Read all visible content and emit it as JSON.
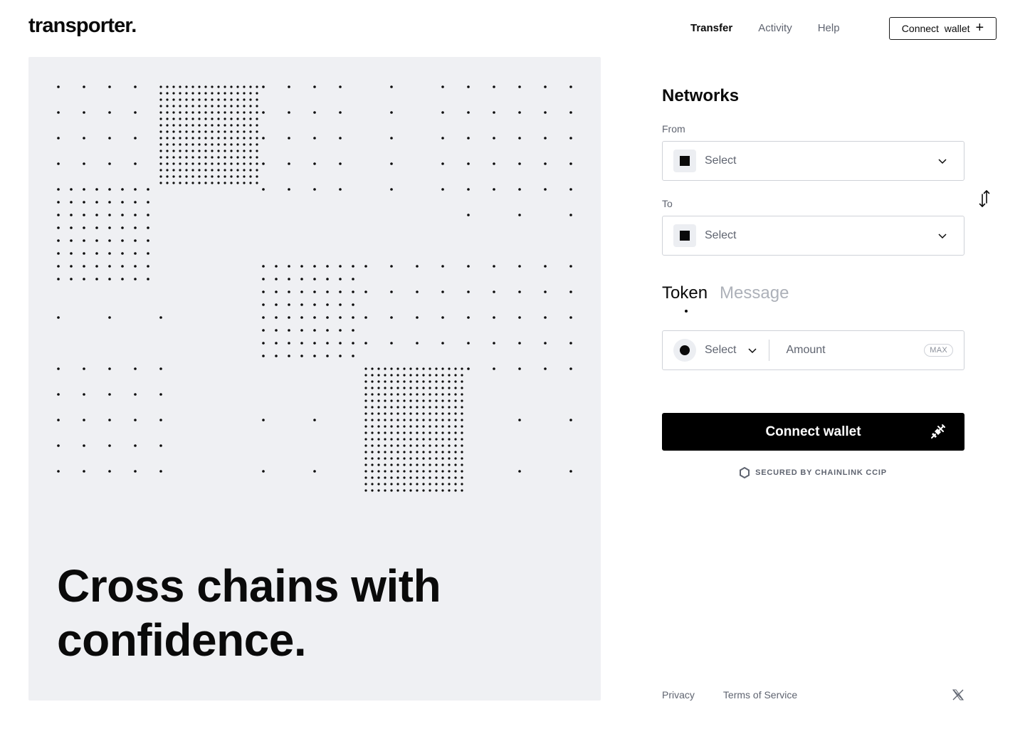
{
  "header": {
    "logo": "transporter.",
    "nav": [
      {
        "label": "Transfer",
        "active": true
      },
      {
        "label": "Activity",
        "active": false
      },
      {
        "label": "Help",
        "active": false
      }
    ],
    "connect_label": "Connect  wallet",
    "connect_icon": "plus-icon"
  },
  "hero": {
    "title": "Cross chains with confidence.",
    "background": "#eff0f3"
  },
  "form": {
    "section_title": "Networks",
    "from": {
      "label": "From",
      "value": "Select"
    },
    "to": {
      "label": "To",
      "value": "Select"
    },
    "swap_icon": "swap-arrows-icon",
    "tabs": [
      {
        "label": "Token",
        "active": true
      },
      {
        "label": "Message",
        "active": false
      }
    ],
    "token": {
      "value": "Select"
    },
    "amount": {
      "placeholder": "Amount",
      "max_label": "MAX"
    },
    "connect_button": "Connect wallet",
    "connect_icon": "plug-icon",
    "secured_text": "SECURED BY CHAINLINK CCIP"
  },
  "footer": {
    "links": [
      "Privacy",
      "Terms of Service"
    ],
    "social_icon": "x-logo-icon"
  },
  "colors": {
    "accent": "#000000",
    "muted_text": "#5f6470",
    "inactive_tab": "#adb1b9",
    "border": "#cfd2d8"
  }
}
